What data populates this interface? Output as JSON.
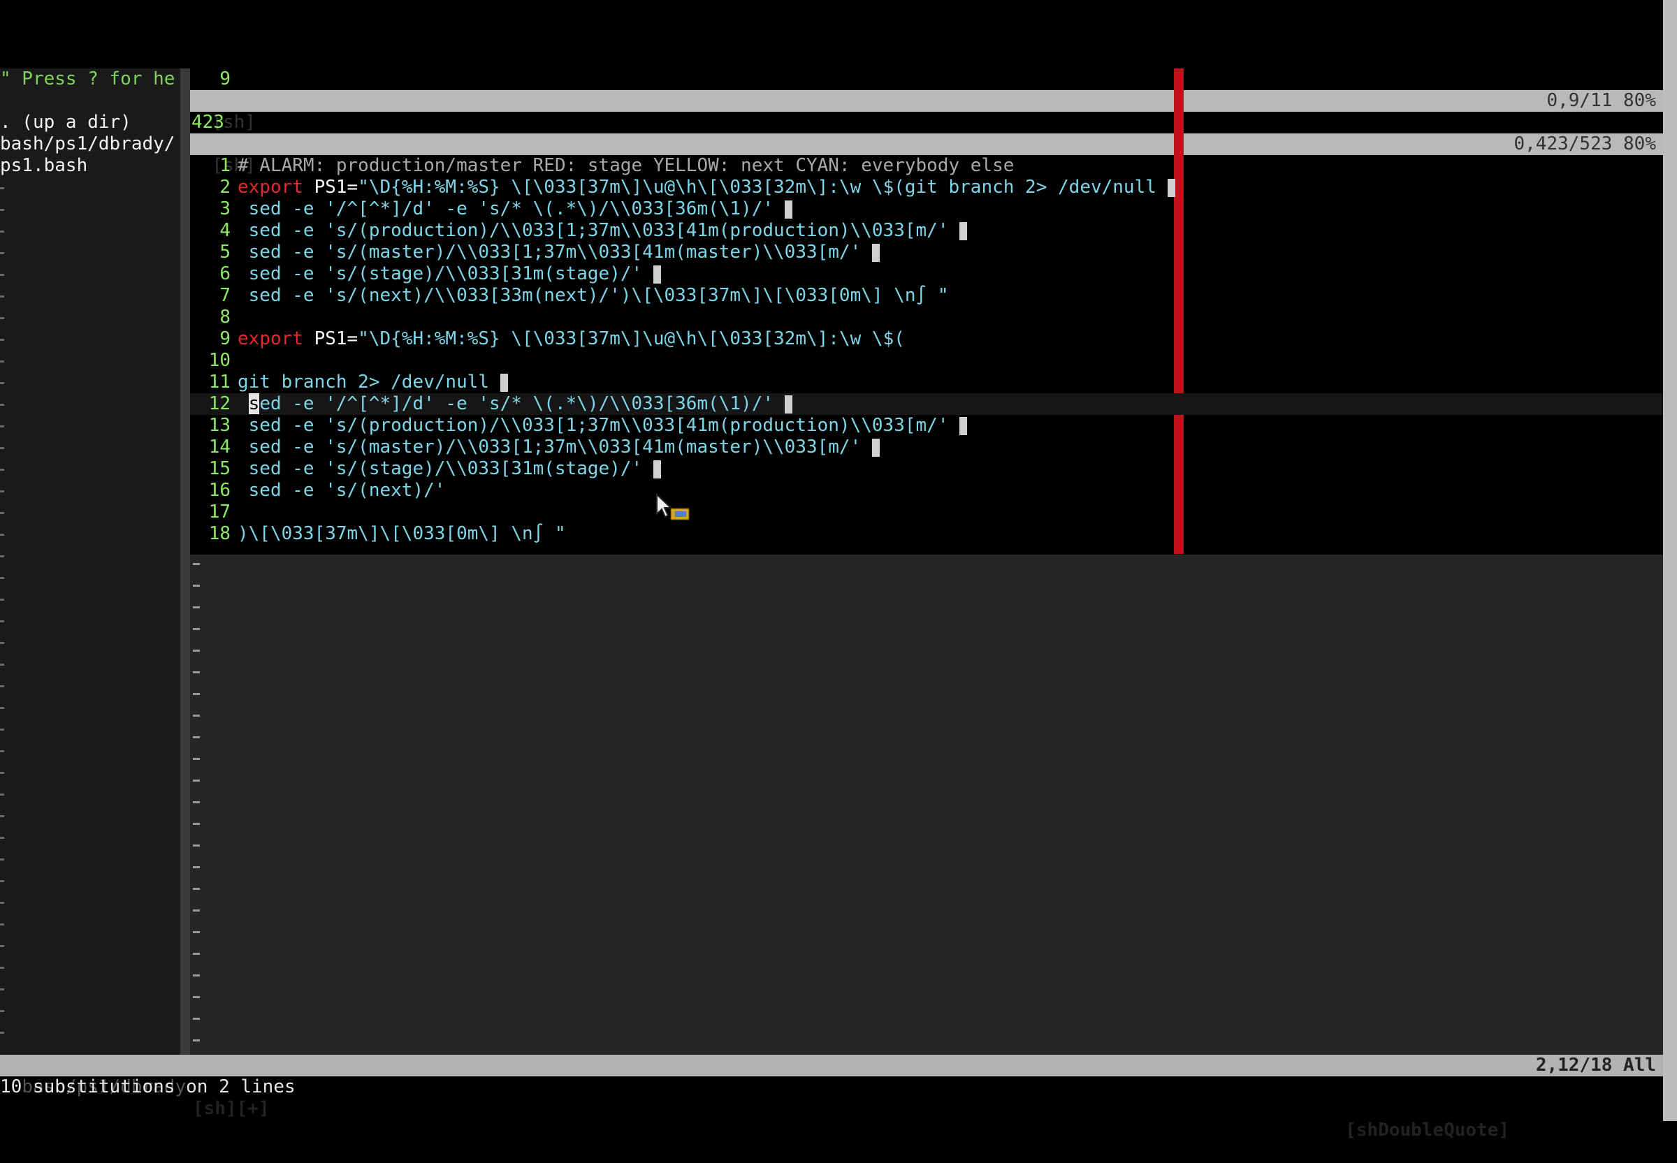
{
  "left_panel": {
    "help_hint": "\" Press ? for he",
    "up_dir": ". (up a dir)",
    "current_dir": "bash/ps1/dbrady/",
    "file": "ps1.bash"
  },
  "top_window": {
    "line_number": "9",
    "status_label": "[sh]",
    "status_position": "0,9/11 80%"
  },
  "middle_window": {
    "line_number": "423",
    "status_label": "[sh]",
    "status_position": "0,423/523 80%"
  },
  "editor": {
    "lines": [
      {
        "n": "1",
        "parts": [
          {
            "t": "# ALARM: production/master RED: stage YELLOW: next CYAN: everybody else",
            "c": "cmt"
          }
        ]
      },
      {
        "n": "2",
        "parts": [
          {
            "t": "export",
            "c": "kw"
          },
          {
            "t": " PS1=",
            "c": "wb"
          },
          {
            "t": "\"\\D{%H:%M:%S} \\[\\033[37m\\]\\u@\\h\\[\\033[32m\\]:\\w \\$(git branch 2> /dev/null ",
            "c": "str"
          },
          {
            "t": "",
            "c": "blk"
          }
        ]
      },
      {
        "n": "3",
        "parts": [
          {
            "t": " sed -e '/^[^*]/d' -e 's/* \\(.*\\)/\\\\033[36m(\\1)/' ",
            "c": "str"
          },
          {
            "t": "",
            "c": "blk"
          }
        ]
      },
      {
        "n": "4",
        "parts": [
          {
            "t": " sed -e 's/(production)/\\\\033[1;37m\\\\033[41m(production)\\\\033[m/' ",
            "c": "str"
          },
          {
            "t": "",
            "c": "blk"
          }
        ]
      },
      {
        "n": "5",
        "parts": [
          {
            "t": " sed -e 's/(master)/\\\\033[1;37m\\\\033[41m(master)\\\\033[m/' ",
            "c": "str"
          },
          {
            "t": "",
            "c": "blk"
          }
        ]
      },
      {
        "n": "6",
        "parts": [
          {
            "t": " sed -e 's/(stage)/\\\\033[31m(stage)/' ",
            "c": "str"
          },
          {
            "t": "",
            "c": "blk"
          }
        ]
      },
      {
        "n": "7",
        "parts": [
          {
            "t": " sed -e 's/(next)/\\\\033[33m(next)/')\\[\\033[37m\\]\\[\\033[0m\\] \\n∫ \"",
            "c": "str"
          }
        ]
      },
      {
        "n": "8",
        "parts": []
      },
      {
        "n": "9",
        "parts": [
          {
            "t": "export",
            "c": "kw"
          },
          {
            "t": " PS1=",
            "c": "wb"
          },
          {
            "t": "\"\\D{%H:%M:%S} \\[\\033[37m\\]\\u@\\h\\[\\033[32m\\]:\\w \\$(",
            "c": "str"
          }
        ]
      },
      {
        "n": "10",
        "parts": []
      },
      {
        "n": "11",
        "parts": [
          {
            "t": "git branch 2> /dev/null ",
            "c": "str"
          },
          {
            "t": "",
            "c": "blk"
          }
        ]
      },
      {
        "n": "12",
        "parts": [
          {
            "t": " ",
            "c": "str"
          },
          {
            "t": "s",
            "c": "cur"
          },
          {
            "t": "ed -e '/^[^*]/d' -e 's/* \\(.*\\)/\\\\033[36m(\\1)/' ",
            "c": "str"
          },
          {
            "t": "",
            "c": "blk"
          }
        ]
      },
      {
        "n": "13",
        "parts": [
          {
            "t": " sed -e 's/(production)/\\\\033[1;37m\\\\033[41m(production)\\\\033[m/' ",
            "c": "str"
          },
          {
            "t": "",
            "c": "blk"
          }
        ]
      },
      {
        "n": "14",
        "parts": [
          {
            "t": " sed -e 's/(master)/\\\\033[1;37m\\\\033[41m(master)\\\\033[m/' ",
            "c": "str"
          },
          {
            "t": "",
            "c": "blk"
          }
        ]
      },
      {
        "n": "15",
        "parts": [
          {
            "t": " sed -e 's/(stage)/\\\\033[31m(stage)/' ",
            "c": "str"
          },
          {
            "t": "",
            "c": "blk"
          }
        ]
      },
      {
        "n": "16",
        "parts": [
          {
            "t": " sed -e 's/(next)/' ",
            "c": "str"
          }
        ]
      },
      {
        "n": "17",
        "parts": []
      },
      {
        "n": "18",
        "parts": [
          {
            "t": ")\\[\\033[37m\\]\\[\\033[0m\\] \\n∫ \"",
            "c": "str"
          }
        ]
      }
    ]
  },
  "statusline": {
    "left_path": "bash/ps1/dbrady",
    "file_flags": "[sh][+]",
    "syntax_group": "[shDoubleQuote]",
    "position": "2,12/18 All"
  },
  "command_line": {
    "message": "10 substitutions on 2 lines"
  },
  "colors": {
    "background": "#000000",
    "line_number": "#8bea62",
    "keyword": "#e8262c",
    "string": "#7dd6e8",
    "color_column": "#c0121b",
    "status_bar": "#b9b9b9"
  },
  "icons": {
    "mouse_cursor": "arrow-pointer-icon"
  }
}
